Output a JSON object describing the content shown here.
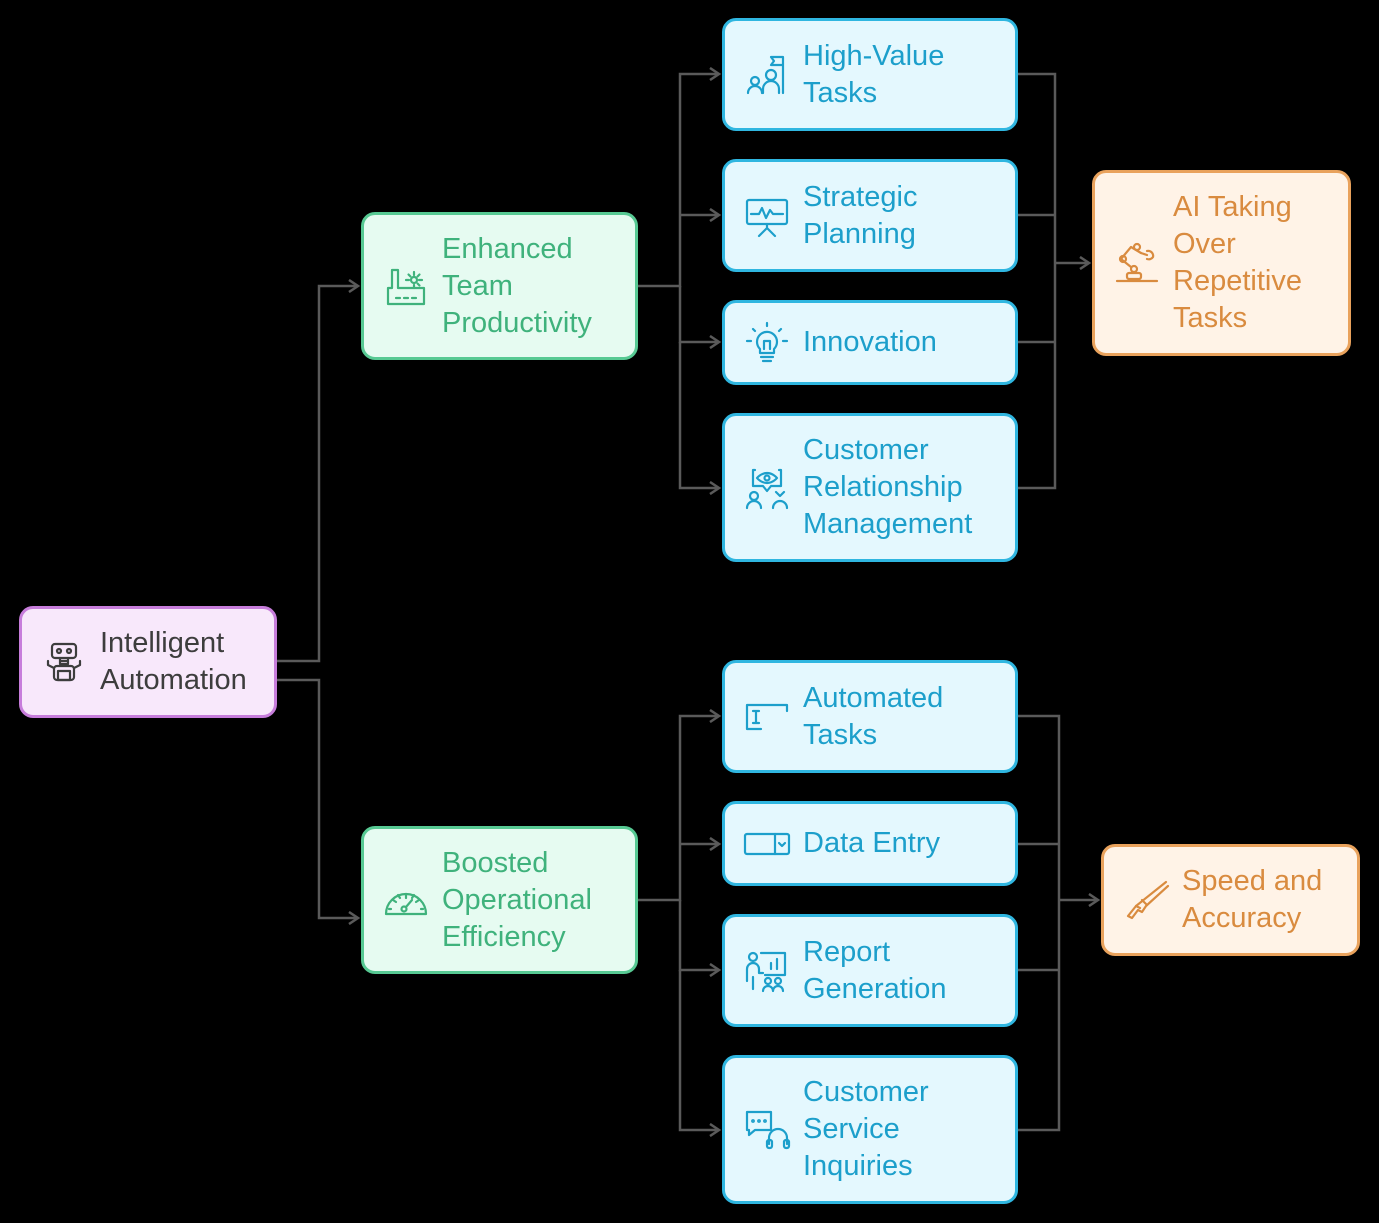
{
  "diagram": {
    "type": "flowchart",
    "direction": "left-to-right",
    "background": "#000000",
    "palette": {
      "root": {
        "fill": "#f8e8fb",
        "border": "#c77ddb",
        "text": "#3d3d3d"
      },
      "branch": {
        "fill": "#e6fbf1",
        "border": "#57c993",
        "text": "#3fb27c"
      },
      "leaf": {
        "fill": "#e4f8fe",
        "border": "#2fb6e0",
        "text": "#1c9fcb"
      },
      "outcome": {
        "fill": "#fff3e7",
        "border": "#e9a25c",
        "text": "#d98b3f"
      },
      "connector": "#5a5a5a"
    },
    "nodes": {
      "root": {
        "label": "Intelligent\nAutomation",
        "icon": "robot-icon"
      },
      "etp": {
        "label": "Enhanced\nTeam\nProductivity",
        "icon": "factory-gear-icon"
      },
      "boe": {
        "label": "Boosted\nOperational\nEfficiency",
        "icon": "speedometer-icon"
      },
      "hvt": {
        "label": "High-Value\nTasks",
        "icon": "team-flag-icon"
      },
      "sp": {
        "label": "Strategic\nPlanning",
        "icon": "presentation-chart-icon"
      },
      "inn": {
        "label": "Innovation",
        "icon": "lightbulb-icon"
      },
      "crm": {
        "label": "Customer\nRelationship\nManagement",
        "icon": "people-eye-icon"
      },
      "at": {
        "label": "Automated\nTasks",
        "icon": "text-cursor-box-icon"
      },
      "de": {
        "label": "Data Entry",
        "icon": "dropdown-field-icon"
      },
      "rg": {
        "label": "Report\nGeneration",
        "icon": "presenter-report-icon"
      },
      "csi": {
        "label": "Customer\nService\nInquiries",
        "icon": "chat-headset-icon"
      },
      "ai": {
        "label": "AI Taking\nOver\nRepetitive\nTasks",
        "icon": "robotic-arm-icon"
      },
      "sa": {
        "label": "Speed and\nAccuracy",
        "icon": "rifle-icon"
      }
    },
    "edges": [
      {
        "from": "root",
        "to": "etp"
      },
      {
        "from": "root",
        "to": "boe"
      },
      {
        "from": "etp",
        "to": "hvt"
      },
      {
        "from": "etp",
        "to": "sp"
      },
      {
        "from": "etp",
        "to": "inn"
      },
      {
        "from": "etp",
        "to": "crm"
      },
      {
        "from": "boe",
        "to": "at"
      },
      {
        "from": "boe",
        "to": "de"
      },
      {
        "from": "boe",
        "to": "rg"
      },
      {
        "from": "boe",
        "to": "csi"
      },
      {
        "from": "hvt",
        "to": "ai"
      },
      {
        "from": "sp",
        "to": "ai"
      },
      {
        "from": "inn",
        "to": "ai"
      },
      {
        "from": "crm",
        "to": "ai"
      },
      {
        "from": "at",
        "to": "sa"
      },
      {
        "from": "de",
        "to": "sa"
      },
      {
        "from": "rg",
        "to": "sa"
      },
      {
        "from": "csi",
        "to": "sa"
      }
    ]
  }
}
